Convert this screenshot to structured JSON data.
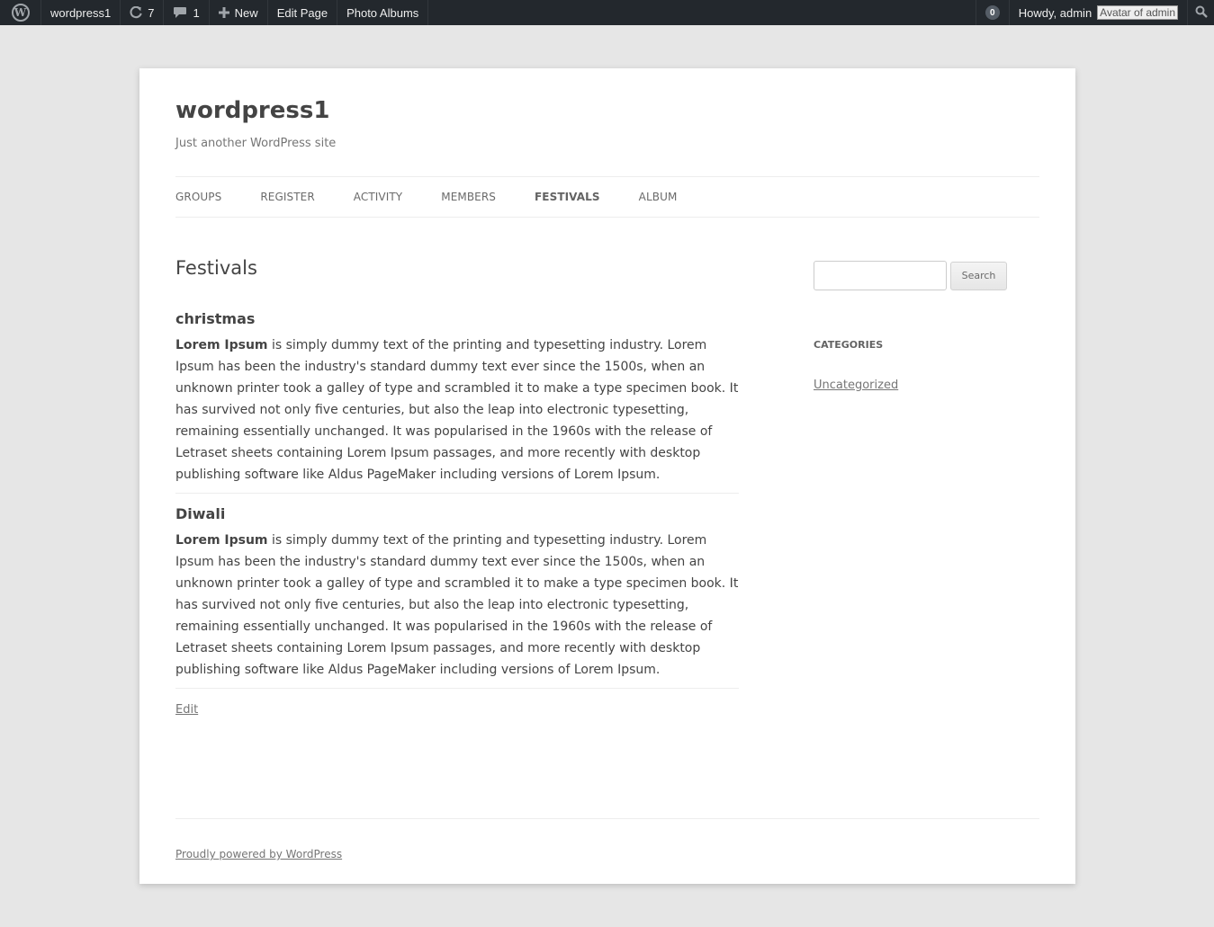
{
  "adminbar": {
    "site_name": "wordpress1",
    "updates_count": "7",
    "comments_count": "1",
    "new_label": "New",
    "edit_page_label": "Edit Page",
    "photo_albums_label": "Photo Albums",
    "notifications_count": "0",
    "howdy": "Howdy, admin",
    "avatar_alt": "Avatar of admin"
  },
  "site": {
    "title": "wordpress1",
    "description": "Just another WordPress site"
  },
  "nav": {
    "items": [
      {
        "label": "GROUPS"
      },
      {
        "label": "REGISTER"
      },
      {
        "label": "ACTIVITY"
      },
      {
        "label": "MEMBERS"
      },
      {
        "label": "FESTIVALS"
      },
      {
        "label": "ALBUM"
      }
    ]
  },
  "main": {
    "title": "Festivals",
    "entries": [
      {
        "heading": "christmas",
        "lead": "Lorem Ipsum",
        "body": " is simply dummy text of the printing and typesetting industry. Lorem Ipsum has been the industry's standard dummy text ever since the 1500s, when an unknown printer took a galley of type and scrambled it to make a type specimen book. It has survived not only five centuries, but also the leap into electronic typesetting, remaining essentially unchanged. It was popularised in the 1960s with the release of Letraset sheets containing Lorem Ipsum passages, and more recently with desktop publishing software like Aldus PageMaker including versions of Lorem Ipsum."
      },
      {
        "heading": "Diwali",
        "lead": "Lorem Ipsum",
        "body": " is simply dummy text of the printing and typesetting industry. Lorem Ipsum has been the industry's standard dummy text ever since the 1500s, when an unknown printer took a galley of type and scrambled it to make a type specimen book. It has survived not only five centuries, but also the leap into electronic typesetting, remaining essentially unchanged. It was popularised in the 1960s with the release of Letraset sheets containing Lorem Ipsum passages, and more recently with desktop publishing software like Aldus PageMaker including versions of Lorem Ipsum."
      }
    ],
    "edit_label": "Edit"
  },
  "sidebar": {
    "search_value": "",
    "search_button": "Search",
    "categories_title": "CATEGORIES",
    "categories": [
      "Uncategorized"
    ]
  },
  "footer": {
    "credit": "Proudly powered by WordPress"
  },
  "icons": {
    "wp": "wordpress-logo-icon",
    "updates": "refresh-icon",
    "comments": "comment-bubble-icon",
    "new": "plus-icon",
    "search": "search-icon"
  },
  "colors": {
    "adminbar_bg": "#23282d",
    "page_bg": "#e6e6e6",
    "content_bg": "#ffffff",
    "text": "#444444"
  }
}
